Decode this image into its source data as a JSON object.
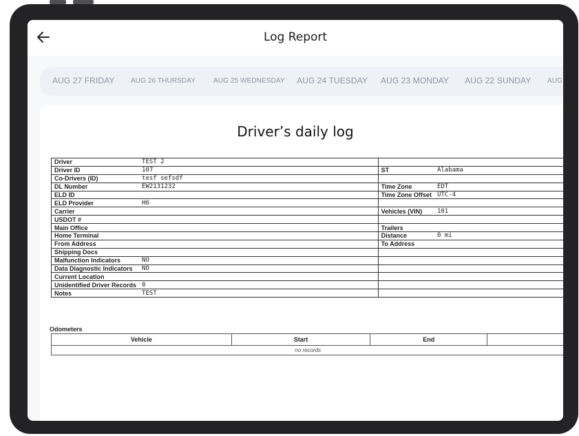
{
  "header": {
    "title": "Log Report",
    "back_icon": "arrow-left-icon"
  },
  "tabs": [
    {
      "label": "AUG 27 FRIDAY"
    },
    {
      "label": "AUG 26 THURSDAY"
    },
    {
      "label": "AUG 25 WEDNESDAY"
    },
    {
      "label": "AUG 24 TUESDAY"
    },
    {
      "label": "AUG 23 MONDAY"
    },
    {
      "label": "AUG 22 SUNDAY"
    },
    {
      "label": "AUG"
    }
  ],
  "log": {
    "title": "Driver’s daily log",
    "rows": [
      {
        "left_label": "Driver",
        "left_value": "TEST 2",
        "right_label": "",
        "right_value": ""
      },
      {
        "left_label": "Driver ID",
        "left_value": "107",
        "right_label": "ST",
        "right_value": "Alabama"
      },
      {
        "left_label": "Co-Drivers (ID)",
        "left_value": "tesf sefsdf",
        "right_label": "",
        "right_value": ""
      },
      {
        "left_label": "DL Number",
        "left_value": "EW2131232",
        "right_label": "Time Zone",
        "right_value": "EDT"
      },
      {
        "left_label": "ELD ID",
        "left_value": "",
        "right_label": "Time Zone Offset",
        "right_value": "UTC-4"
      },
      {
        "left_label": "ELD Provider",
        "left_value": "H6",
        "right_label": "",
        "right_value": ""
      },
      {
        "left_label": "Carrier",
        "left_value": "",
        "right_label": "Vehicles (VIN)",
        "right_value": "101"
      },
      {
        "left_label": "USDOT #",
        "left_value": "",
        "right_label": "",
        "right_value": ""
      },
      {
        "left_label": "Main Office",
        "left_value": "",
        "right_label": "Trailers",
        "right_value": ""
      },
      {
        "left_label": "Home Terminal",
        "left_value": "",
        "right_label": "Distance",
        "right_value": "0 mi"
      },
      {
        "left_label": "From Address",
        "left_value": "",
        "right_label": "To Address",
        "right_value": ""
      },
      {
        "left_label": "Shipping Docs",
        "left_value": "",
        "right_label": "",
        "right_value": ""
      },
      {
        "left_label": "Malfunction Indicators",
        "left_value": "NO",
        "right_label": "",
        "right_value": ""
      },
      {
        "left_label": "Data Diagnostic Indicators",
        "left_value": "NO",
        "right_label": "",
        "right_value": ""
      },
      {
        "left_label": "Current Location",
        "left_value": "",
        "right_label": "",
        "right_value": ""
      },
      {
        "left_label": "Unidentified Driver Records",
        "left_value": "0",
        "right_label": "",
        "right_value": ""
      },
      {
        "left_label": "Notes",
        "left_value": "TEST",
        "right_label": "",
        "right_value": ""
      }
    ]
  },
  "odometers": {
    "title": "Odometers",
    "columns": [
      "Vehicle",
      "Start",
      "End",
      ""
    ],
    "empty_text": "no records"
  }
}
